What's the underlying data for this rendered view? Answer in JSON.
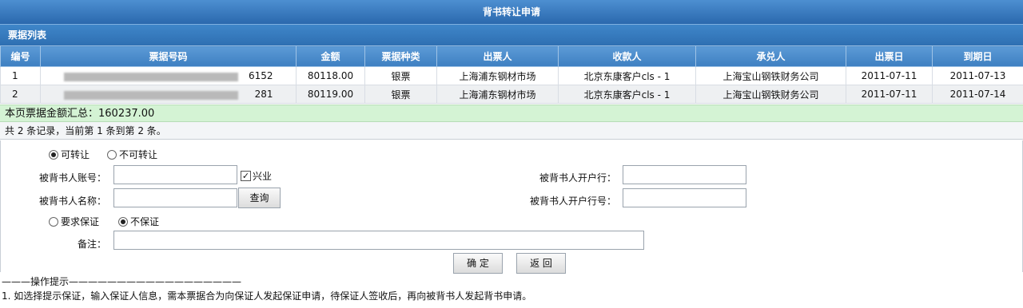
{
  "window_title": "背书转让申请",
  "section_title": "票据列表",
  "table": {
    "headers": [
      "编号",
      "票据号码",
      "金额",
      "票据种类",
      "出票人",
      "收款人",
      "承兑人",
      "出票日",
      "到期日"
    ],
    "rows": [
      {
        "no": "1",
        "bill_no_suffix": "6152",
        "amount": "80118.00",
        "type": "银票",
        "drawer": "上海浦东钢材市场",
        "payee": "北京东康客户cls - 1",
        "acceptor": "上海宝山钢铁财务公司",
        "issue_date": "2011-07-11",
        "due_date": "2011-07-13"
      },
      {
        "no": "2",
        "bill_no_suffix": "281",
        "amount": "80119.00",
        "type": "银票",
        "drawer": "上海浦东钢材市场",
        "payee": "北京东康客户cls - 1",
        "acceptor": "上海宝山钢铁财务公司",
        "issue_date": "2011-07-11",
        "due_date": "2011-07-14"
      }
    ]
  },
  "summary_text": "本页票据金额汇总：160237.00",
  "paging_text": "共 2 条记录，当前第 1 条到第 2 条。",
  "form": {
    "transfer_options": [
      {
        "label": "可转让",
        "checked": true
      },
      {
        "label": "不可转让",
        "checked": false
      }
    ],
    "endorsee_account_label": "被背书人账号：",
    "endorsee_account_value": "",
    "xingye_label": "兴业",
    "xingye_checked": true,
    "endorsee_name_label": "被背书人名称：",
    "endorsee_name_value": "",
    "query_button": "查询",
    "endorsee_bank_label": "被背书人开户行：",
    "endorsee_bank_value": "",
    "endorsee_bank_no_label": "被背书人开户行号：",
    "endorsee_bank_no_value": "",
    "guarantee_options": [
      {
        "label": "要求保证",
        "checked": false
      },
      {
        "label": "不保证",
        "checked": true
      }
    ],
    "remark_label": "备注：",
    "remark_value": "",
    "confirm_button": "确 定",
    "back_button": "返 回"
  },
  "tips": {
    "header": "———操作提示——————————————————",
    "line1": "1.  如选择提示保证，输入保证人信息，需本票据合为向保证人发起保证申请，待保证人签收后，再向被背书人发起背书申请。"
  }
}
